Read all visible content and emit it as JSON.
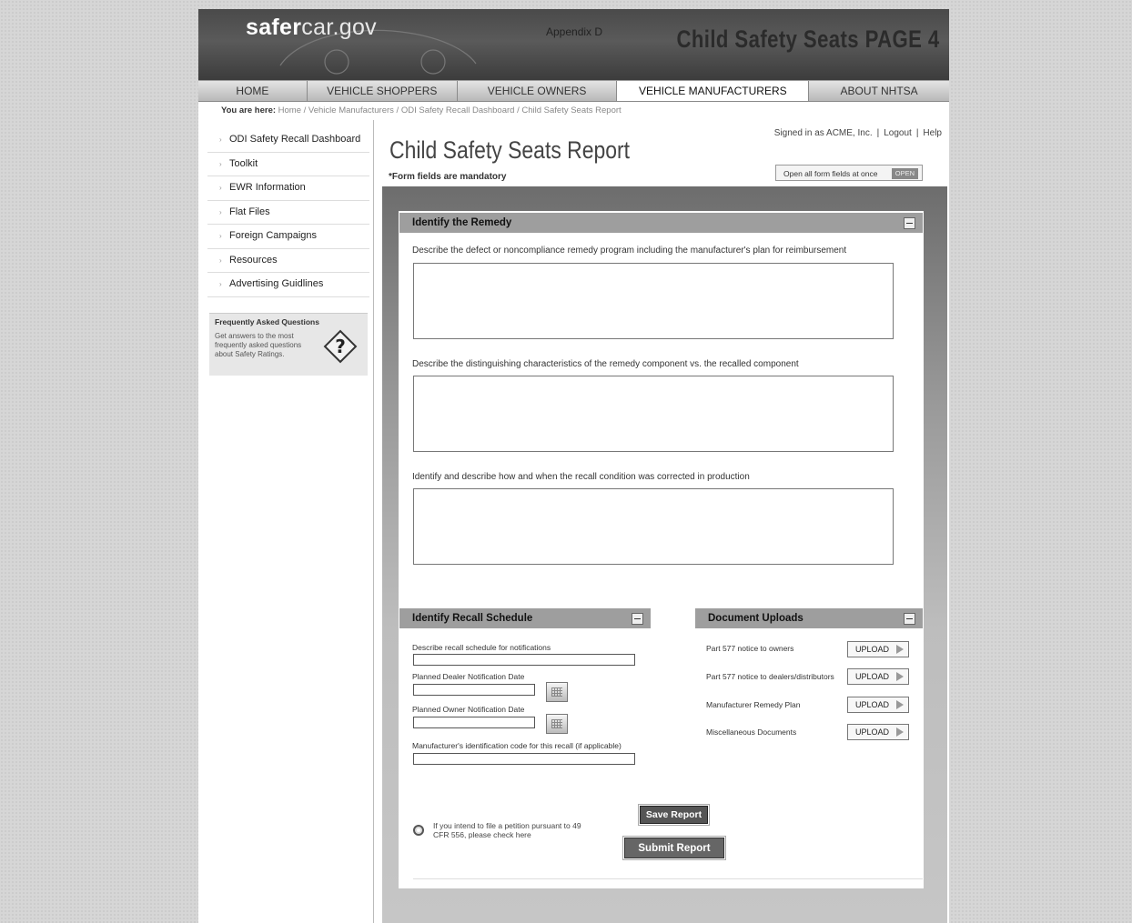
{
  "header": {
    "logo_bold": "safer",
    "logo_rest": "car.gov",
    "appendix": "Appendix D",
    "page_heading": "Child Safety Seats PAGE 4"
  },
  "nav": {
    "tabs": [
      {
        "label": "HOME"
      },
      {
        "label": "VEHICLE SHOPPERS"
      },
      {
        "label": "VEHICLE OWNERS"
      },
      {
        "label": "VEHICLE MANUFACTURERS",
        "active": true
      },
      {
        "label": "ABOUT NHTSA"
      }
    ]
  },
  "breadcrumb": {
    "prefix": "You are here:",
    "path": "Home / Vehicle Manufacturers / ODI Safety Recall Dashboard / Child Safety Seats Report"
  },
  "sidebar": {
    "items": [
      {
        "label": "ODI Safety Recall Dashboard"
      },
      {
        "label": "Toolkit"
      },
      {
        "label": "EWR Information"
      },
      {
        "label": "Flat Files"
      },
      {
        "label": "Foreign Campaigns"
      },
      {
        "label": "Resources"
      },
      {
        "label": "Advertising Guidlines"
      }
    ],
    "faq": {
      "title": "Frequently Asked Questions",
      "text": "Get answers to the most frequently asked questions about Safety Ratings."
    }
  },
  "account": {
    "signed_in": "Signed in as ACME, Inc.",
    "logout": "Logout",
    "help": "Help"
  },
  "report": {
    "title": "Child Safety Seats Report",
    "mandatory_note": "*Form fields are mandatory",
    "open_all_label": "Open all form fields at once",
    "open_button": "OPEN"
  },
  "remedy": {
    "heading": "Identify the Remedy",
    "q1": "Describe the defect or noncompliance remedy program including the manufacturer's plan for reimbursement",
    "q2": "Describe the distinguishing characteristics of the remedy component vs. the recalled component",
    "q3": "Identify and describe how and when the recall condition was corrected in production"
  },
  "schedule": {
    "heading": "Identify Recall Schedule",
    "f1": "Describe recall schedule for notifications",
    "f2": "Planned Dealer Notification Date",
    "f3": "Planned Owner Notification Date",
    "f4": "Manufacturer's identification code for this recall (if applicable)"
  },
  "uploads": {
    "heading": "Document Uploads",
    "button": "UPLOAD",
    "items": [
      {
        "label": "Part 577 notice to owners"
      },
      {
        "label": "Part 577 notice to dealers/distributors"
      },
      {
        "label": "Manufacturer Remedy Plan"
      },
      {
        "label": "Miscellaneous Documents"
      }
    ]
  },
  "petition": {
    "text": "If you intend to file a petition pursuant to 49 CFR 556, please check here"
  },
  "actions": {
    "save": "Save Report",
    "submit": "Submit Report"
  }
}
